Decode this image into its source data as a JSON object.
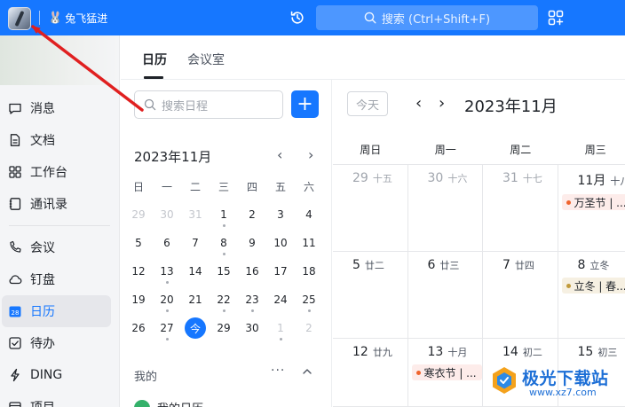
{
  "header": {
    "org_name": "兔飞猛进",
    "search_placeholder": "搜索 (Ctrl+Shift+F)",
    "icons": [
      "app-logo",
      "rabbit-icon",
      "history-icon",
      "search-icon",
      "apps-grid-icon"
    ]
  },
  "sidebar": {
    "items": [
      {
        "label": "消息",
        "icon": "message-icon"
      },
      {
        "label": "文档",
        "icon": "document-icon"
      },
      {
        "label": "工作台",
        "icon": "workbench-icon"
      },
      {
        "label": "通讯录",
        "icon": "contacts-icon"
      },
      {
        "label": "会议",
        "icon": "meeting-icon"
      },
      {
        "label": "钉盘",
        "icon": "cloud-drive-icon"
      },
      {
        "label": "日历",
        "icon": "calendar-icon",
        "active": true,
        "badge": "28"
      },
      {
        "label": "待办",
        "icon": "todo-icon"
      },
      {
        "label": "DING",
        "icon": "ding-icon"
      },
      {
        "label": "项目",
        "icon": "project-icon"
      }
    ]
  },
  "tabs": [
    {
      "label": "日历",
      "active": true
    },
    {
      "label": "会议室",
      "active": false
    }
  ],
  "mini_calendar": {
    "search_placeholder": "搜索日程",
    "add_label": "+",
    "month_title": "2023年11月",
    "prev": "‹",
    "next": "›",
    "weekdays": [
      "日",
      "一",
      "二",
      "三",
      "四",
      "五",
      "六"
    ],
    "weeks": [
      [
        {
          "d": "29",
          "m": true
        },
        {
          "d": "30",
          "m": true
        },
        {
          "d": "31",
          "m": true
        },
        {
          "d": "1",
          "dot": true
        },
        {
          "d": "2"
        },
        {
          "d": "3"
        },
        {
          "d": "4"
        }
      ],
      [
        {
          "d": "5"
        },
        {
          "d": "6"
        },
        {
          "d": "7"
        },
        {
          "d": "8",
          "dot": true
        },
        {
          "d": "9"
        },
        {
          "d": "10"
        },
        {
          "d": "11"
        }
      ],
      [
        {
          "d": "12"
        },
        {
          "d": "13",
          "dot": true
        },
        {
          "d": "14"
        },
        {
          "d": "15"
        },
        {
          "d": "16"
        },
        {
          "d": "17"
        },
        {
          "d": "18"
        }
      ],
      [
        {
          "d": "19"
        },
        {
          "d": "20",
          "dot": true
        },
        {
          "d": "21"
        },
        {
          "d": "22",
          "dot": true
        },
        {
          "d": "23",
          "dot": true
        },
        {
          "d": "24"
        },
        {
          "d": "25",
          "dot": true
        }
      ],
      [
        {
          "d": "26"
        },
        {
          "d": "27",
          "dot": true
        },
        {
          "d": "今",
          "today": true
        },
        {
          "d": "29"
        },
        {
          "d": "30"
        },
        {
          "d": "1",
          "m": true,
          "dot": true
        },
        {
          "d": "2",
          "m": true
        }
      ]
    ],
    "mine_label": "我的",
    "mine_more": "···",
    "my_calendar_label": "我的日历"
  },
  "main_calendar": {
    "today_label": "今天",
    "prev": "‹",
    "next": "›",
    "title": "2023年11月",
    "weekdays": [
      "周日",
      "周一",
      "周二",
      "周三"
    ],
    "weeks": [
      [
        {
          "num": "29",
          "lunar": "十五",
          "muted": true
        },
        {
          "num": "30",
          "lunar": "十六",
          "muted": true
        },
        {
          "num": "31",
          "lunar": "十七",
          "muted": true
        },
        {
          "num": "11月",
          "lunar": "十八",
          "event": {
            "label": "万圣节 | ...",
            "color": "#f0642d",
            "bg": "#fdecea"
          }
        }
      ],
      [
        {
          "num": "5",
          "lunar": "廿二"
        },
        {
          "num": "6",
          "lunar": "廿三"
        },
        {
          "num": "7",
          "lunar": "廿四"
        },
        {
          "num": "8",
          "lunar": "立冬",
          "event": {
            "label": "立冬 | 春...",
            "color": "#c19a3b",
            "bg": "#f6f0e2"
          }
        }
      ],
      [
        {
          "num": "12",
          "lunar": "廿九"
        },
        {
          "num": "13",
          "lunar": "十月",
          "event": {
            "label": "寒衣节 | ...",
            "color": "#f0642d",
            "bg": "#fdecea"
          }
        },
        {
          "num": "14",
          "lunar": "初二"
        },
        {
          "num": "15",
          "lunar": "初三"
        }
      ]
    ]
  },
  "watermark": {
    "title": "极光下载站",
    "url": "www.xz7.com"
  },
  "colors": {
    "brand_blue": "#1677ff",
    "annotation_arrow": "#e02020"
  }
}
